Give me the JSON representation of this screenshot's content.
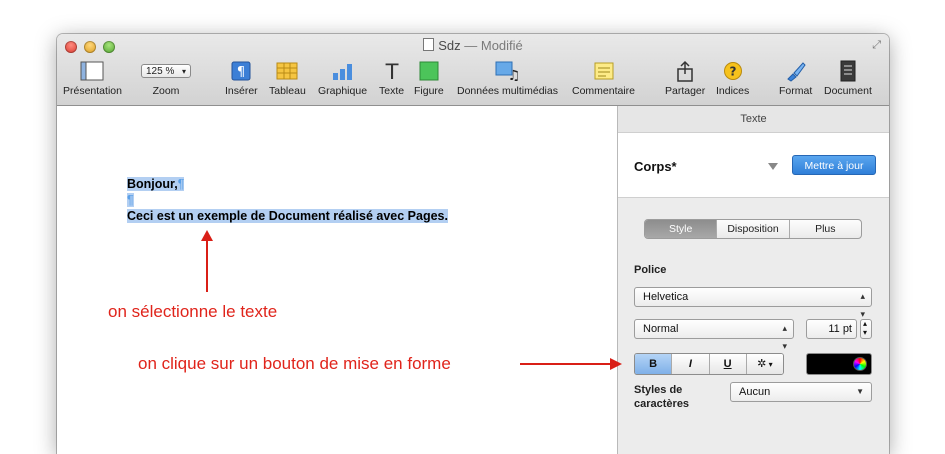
{
  "window": {
    "title": "Sdz",
    "status": "— Modifié"
  },
  "toolbar": {
    "presentation": "Présentation",
    "zoom_value": "125 %",
    "zoom": "Zoom",
    "inserer": "Insérer",
    "tableau": "Tableau",
    "graphique": "Graphique",
    "texte": "Texte",
    "figure": "Figure",
    "multimedia": "Données multimédias",
    "commentaire": "Commentaire",
    "partager": "Partager",
    "indices": "Indices",
    "format": "Format",
    "document": "Document"
  },
  "document": {
    "line1": "Bonjour,",
    "line3": "Ceci est un exemple de Document réalisé avec Pages.",
    "pilcrow": "¶"
  },
  "inspector": {
    "header": "Texte",
    "style_name": "Corps*",
    "update_button": "Mettre à jour",
    "tabs": [
      "Style",
      "Disposition",
      "Plus"
    ],
    "police_label": "Police",
    "font_family": "Helvetica",
    "font_style": "Normal",
    "font_size": "11 pt",
    "bold": "B",
    "italic": "I",
    "underline": "U",
    "gear": "✲",
    "char_styles_label_1": "Styles de",
    "char_styles_label_2": "caractères",
    "char_styles_value": "Aucun"
  },
  "annotations": {
    "select": "on sélectionne le texte",
    "click": "on clique sur un bouton de mise en forme"
  },
  "colors": {
    "annotation": "#e0241b",
    "selection": "#b3cff2",
    "accent": "#2f7fd8"
  }
}
